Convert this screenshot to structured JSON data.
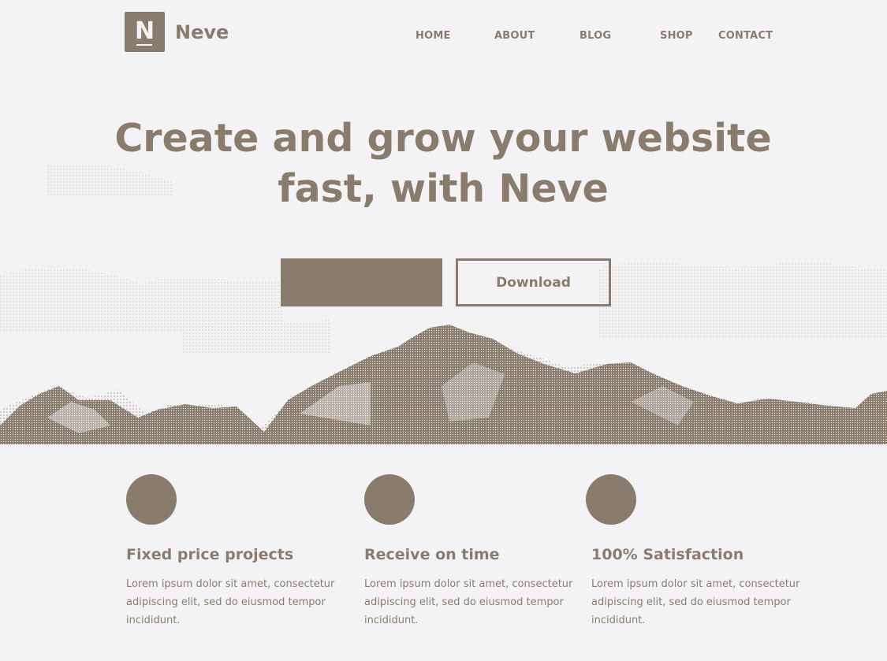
{
  "brand": {
    "logo_letter": "N",
    "name": "Neve"
  },
  "nav": {
    "items": [
      {
        "label": "HOME"
      },
      {
        "label": "ABOUT"
      },
      {
        "label": "BLOG"
      },
      {
        "label": "SHOP"
      },
      {
        "label": "CONTACT"
      }
    ]
  },
  "hero": {
    "title_line1": "Create and grow your website",
    "title_line2": "fast, with Neve",
    "primary_button": "",
    "secondary_button": "Download"
  },
  "features": [
    {
      "icon": "circle-icon",
      "title": "Fixed price projects",
      "text": "Lorem ipsum dolor sit amet, consectetur adipiscing elit, sed do eiusmod tempor incididunt."
    },
    {
      "icon": "circle-icon",
      "title": "Receive on time",
      "text": "Lorem ipsum dolor sit amet, consectetur adipiscing elit, sed do eiusmod tempor incididunt."
    },
    {
      "icon": "circle-icon",
      "title": "100% Satisfaction",
      "text": "Lorem ipsum dolor sit amet, consectetur adipiscing elit, sed do eiusmod tempor incididunt."
    }
  ],
  "colors": {
    "accent": "#8a7c6d",
    "background": "#f3f3f5"
  }
}
